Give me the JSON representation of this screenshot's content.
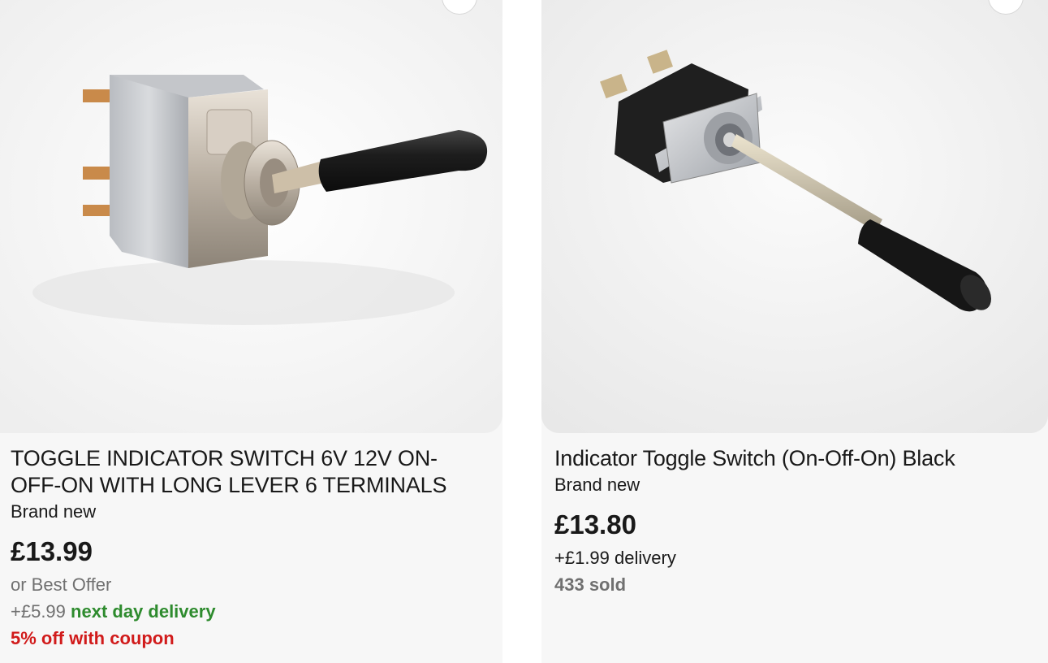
{
  "listings": [
    {
      "title": "TOGGLE INDICATOR SWITCH 6V 12V ON-OFF-ON WITH LONG LEVER 6 TERMINALS",
      "title_line1": "TOGGLE INDICATOR SWITCH 6V 12V ON-",
      "title_line2": "OFF-ON WITH LONG LEVER 6 TERMINALS",
      "condition": "Brand new",
      "price": "£13.99",
      "offer": "or Best Offer",
      "shipping_cost": "+£5.99",
      "shipping_label": "next day delivery",
      "coupon": "5% off with coupon",
      "image_icon": "toggle-switch-photo"
    },
    {
      "title": "Indicator Toggle Switch (On-Off-On) Black",
      "condition": "Brand new",
      "price": "£13.80",
      "shipping": "+£1.99 delivery",
      "sold": "433 sold",
      "image_icon": "toggle-switch-photo"
    }
  ],
  "colors": {
    "text": "#191919",
    "muted": "#707070",
    "delivery_green": "#2e8b2e",
    "coupon_red": "#d11b1b",
    "card_bg": "#f7f7f7"
  }
}
